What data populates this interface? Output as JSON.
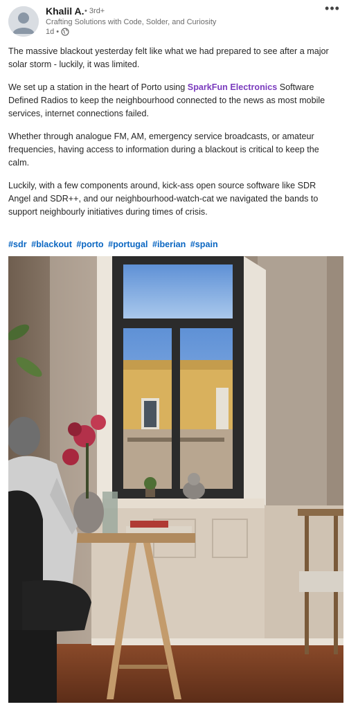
{
  "author": {
    "name": "Khalil A.",
    "degree": "• 3rd+",
    "headline": "Crafting Solutions with Code, Solder, and Curiosity",
    "time": "1d •"
  },
  "icons": {
    "more": "more-options-icon",
    "globe": "globe-icon",
    "avatar": "person-silhouette-icon"
  },
  "post": {
    "p1": "The massive blackout yesterday felt like what we had prepared to see after a major solar storm - luckily, it was limited.",
    "p2_before": "We set up a station in the heart of Porto using ",
    "p2_mention": "SparkFun Electronics",
    "p2_after": " Software Defined Radios to keep the neighbourhood connected to the news as most mobile services, internet connections failed.",
    "p3": "Whether through analogue FM, AM, emergency service broadcasts, or amateur frequencies, having access to information during a blackout is critical to keep the calm.",
    "p4": "Luckily, with a few components around, kick-ass open source software like SDR Angel and SDR++, and our neighbourhood-watch-cat we navigated the bands to support neighbourly initiatives during times of crisis."
  },
  "hashtags": [
    "#sdr",
    "#blackout",
    "#porto",
    "#portugal",
    "#iberian",
    "#spain"
  ],
  "colors": {
    "mention": "#7a3bbd",
    "hashtag": "#0a66c2"
  }
}
